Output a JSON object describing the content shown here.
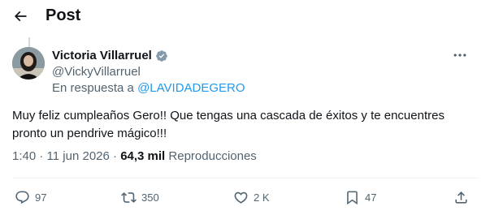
{
  "header": {
    "title": "Post",
    "back_icon": "arrow-left-icon"
  },
  "author": {
    "display_name": "Victoria Villarruel",
    "handle": "@VickyVillarruel",
    "verified_icon": "verified-badge-icon",
    "verified_color": "#829aab"
  },
  "reply": {
    "prefix": "En respuesta a ",
    "to_handle": "@LAVIDADEGERO"
  },
  "tweet": {
    "text": "Muy feliz cumpleaños Gero!! Que tengas una cascada de éxitos y te encuentres\npronto un pendrive mágico!!!"
  },
  "meta": {
    "time": "1:40",
    "separator": " · ",
    "date": "11 jun 2026",
    "views_count": "64,3 mil",
    "views_label": " Reproducciones"
  },
  "actions": {
    "replies": "97",
    "retweets": "350",
    "likes": "2 K",
    "bookmarks": "47"
  },
  "colors": {
    "text": "#0f1419",
    "secondary": "#536471",
    "link": "#1d9bf0",
    "divider": "#eff3f4"
  }
}
